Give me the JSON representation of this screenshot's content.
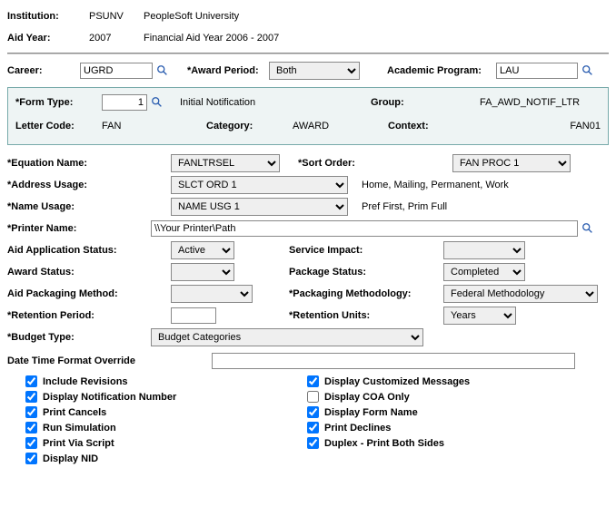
{
  "header": {
    "institution_label": "Institution:",
    "institution_code": "PSUNV",
    "institution_name": "PeopleSoft University",
    "aid_year_label": "Aid Year:",
    "aid_year_code": "2007",
    "aid_year_name": "Financial Aid Year 2006 - 2007"
  },
  "keys": {
    "career_label": "Career:",
    "career_value": "UGRD",
    "award_period_label": "*Award Period:",
    "award_period_value": "Both",
    "academic_program_label": "Academic Program:",
    "academic_program_value": "LAU"
  },
  "formbox": {
    "form_type_label": "*Form Type:",
    "form_type_value": "1",
    "form_type_desc": "Initial Notification",
    "group_label": "Group:",
    "group_value": "FA_AWD_NOTIF_LTR",
    "letter_code_label": "Letter Code:",
    "letter_code_value": "FAN",
    "category_label": "Category:",
    "category_value": "AWARD",
    "context_label": "Context:",
    "context_value": "FAN01"
  },
  "params": {
    "equation_label": "*Equation Name:",
    "equation_value": "FANLTRSEL",
    "sort_order_label": "*Sort Order:",
    "sort_order_value": "FAN PROC 1",
    "address_usage_label": "*Address Usage:",
    "address_usage_value": "SLCT ORD 1",
    "address_usage_desc": "Home, Mailing, Permanent, Work",
    "name_usage_label": "*Name Usage:",
    "name_usage_value": "NAME USG 1",
    "name_usage_desc": "Pref First, Prim Full",
    "printer_label": "*Printer Name:",
    "printer_value": "\\\\Your Printer\\Path",
    "aid_app_status_label": "Aid Application Status:",
    "aid_app_status_value": "Active",
    "service_impact_label": "Service Impact:",
    "service_impact_value": "",
    "award_status_label": "Award Status:",
    "award_status_value": "",
    "package_status_label": "Package Status:",
    "package_status_value": "Completed",
    "aid_pkg_method_label": "Aid Packaging Method:",
    "aid_pkg_method_value": "",
    "pkg_methodology_label": "*Packaging Methodology:",
    "pkg_methodology_value": "Federal Methodology",
    "retention_period_label": "*Retention Period:",
    "retention_period_value": "",
    "retention_units_label": "*Retention Units:",
    "retention_units_value": "Years",
    "budget_type_label": "*Budget Type:",
    "budget_type_value": "Budget Categories",
    "dt_override_label": "Date Time Format Override",
    "dt_override_value": ""
  },
  "checks": {
    "include_revisions": "Include Revisions",
    "display_notif_number": "Display Notification Number",
    "print_cancels": "Print Cancels",
    "run_simulation": "Run Simulation",
    "print_via_script": "Print Via Script",
    "display_nid": "Display NID",
    "display_custom_msgs": "Display Customized Messages",
    "display_coa_only": "Display COA Only",
    "display_form_name": "Display Form Name",
    "print_declines": "Print Declines",
    "duplex": "Duplex - Print Both Sides"
  }
}
